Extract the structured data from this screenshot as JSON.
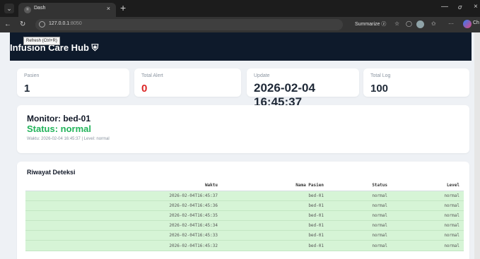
{
  "browser": {
    "tab_title": "Dash",
    "tab_close": "×",
    "new_tab": "+",
    "url_host": "127.0.0.1",
    "url_port": ":8050",
    "summarize_label": "Summarize",
    "copilot_label": "Ch",
    "tooltip": "Refresh (Ctrl+R)",
    "icons": [
      "tab-actions-icon",
      "back-icon",
      "refresh-icon",
      "info-icon",
      "favorite-icon",
      "extension-icon",
      "collections-icon",
      "profile-avatar",
      "more-icon",
      "copilot-icon"
    ]
  },
  "app": {
    "brand": "Infusion Care Hub ⛨",
    "stats": [
      {
        "label": "Pasien",
        "value": "1"
      },
      {
        "label": "Total Alert",
        "value": "0"
      },
      {
        "label": "Update",
        "value": "2026-02-04 16:45:37"
      },
      {
        "label": "Total Log",
        "value": "100"
      }
    ],
    "monitor": {
      "title": "Monitor: bed-01",
      "status": "Status: normal",
      "meta": "Waktu: 2026-02-04 16:45:37 | Level: normal"
    },
    "history": {
      "title": "Riwayat Deteksi",
      "columns": [
        "Waktu",
        "Nama Pasien",
        "Status",
        "Level"
      ],
      "rows": [
        [
          "2026-02-04T16:45:37",
          "bed-01",
          "normal",
          "normal"
        ],
        [
          "2026-02-04T16:45:36",
          "bed-01",
          "normal",
          "normal"
        ],
        [
          "2026-02-04T16:45:35",
          "bed-01",
          "normal",
          "normal"
        ],
        [
          "2026-02-04T16:45:34",
          "bed-01",
          "normal",
          "normal"
        ],
        [
          "2026-02-04T16:45:33",
          "bed-01",
          "normal",
          "normal"
        ],
        [
          "2026-02-04T16:45:32",
          "bed-01",
          "normal",
          "normal"
        ]
      ]
    },
    "colors": {
      "navbar": "#0e1a2b",
      "status_ok": "#22b35a",
      "alert": "#dc2626",
      "row_ok": "#d6f4d6"
    }
  }
}
